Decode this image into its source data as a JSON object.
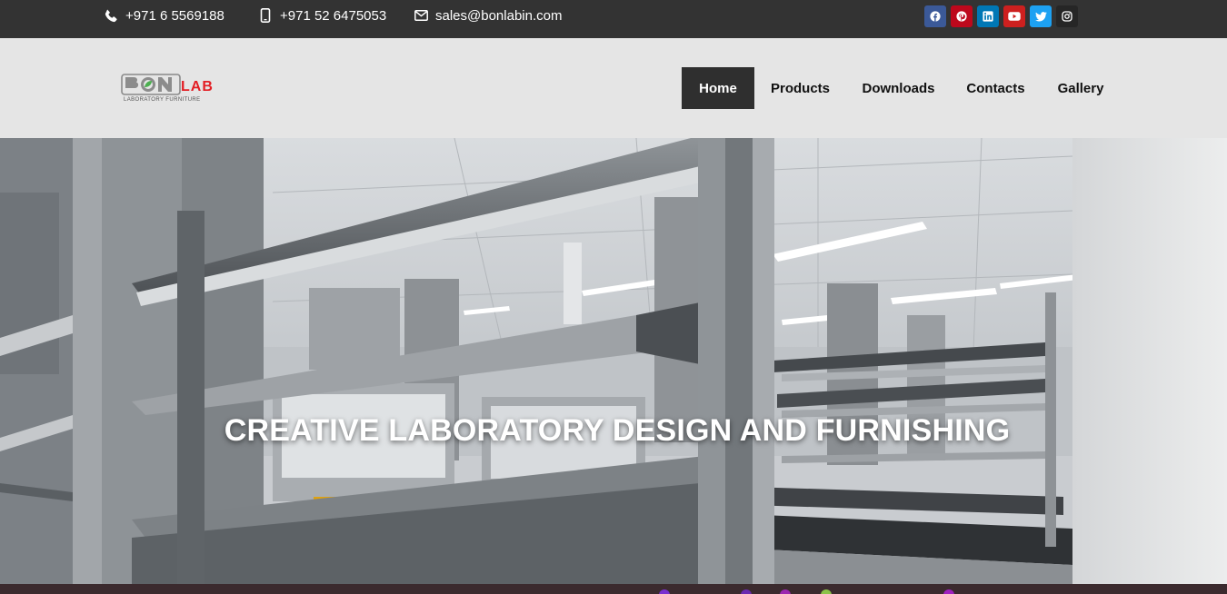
{
  "topbar": {
    "phone": "+971 6 5569188",
    "mobile": "+971 52 6475053",
    "email": "sales@bonlabin.com",
    "icons": {
      "phone": "phone-icon",
      "mobile": "mobile-icon",
      "email": "envelope-icon"
    },
    "socials": [
      {
        "name": "facebook",
        "color": "#3b5998"
      },
      {
        "name": "pinterest",
        "color": "#bd081c"
      },
      {
        "name": "linkedin",
        "color": "#0077b5"
      },
      {
        "name": "youtube",
        "color": "#cd201f"
      },
      {
        "name": "twitter",
        "color": "#1da1f2"
      },
      {
        "name": "instagram",
        "color": "#262626"
      }
    ],
    "background": "#333333"
  },
  "header": {
    "background": "#e5e5e5",
    "logo": {
      "text_main": "BON",
      "text_accent": "LAB",
      "tagline": "LABORATORY FURNITURE"
    }
  },
  "nav": {
    "items": [
      {
        "label": "Home",
        "active": true
      },
      {
        "label": "Products",
        "active": false
      },
      {
        "label": "Downloads",
        "active": false
      },
      {
        "label": "Contacts",
        "active": false
      },
      {
        "label": "Gallery",
        "active": false
      }
    ],
    "active_color": "#2f2f2f"
  },
  "hero": {
    "title": "CREATIVE LABORATORY DESIGN AND FURNISHING",
    "image": "laboratory-shelving-photo"
  },
  "colors": {
    "accent_red": "#e31e24",
    "logo_green": "#4caf50"
  }
}
